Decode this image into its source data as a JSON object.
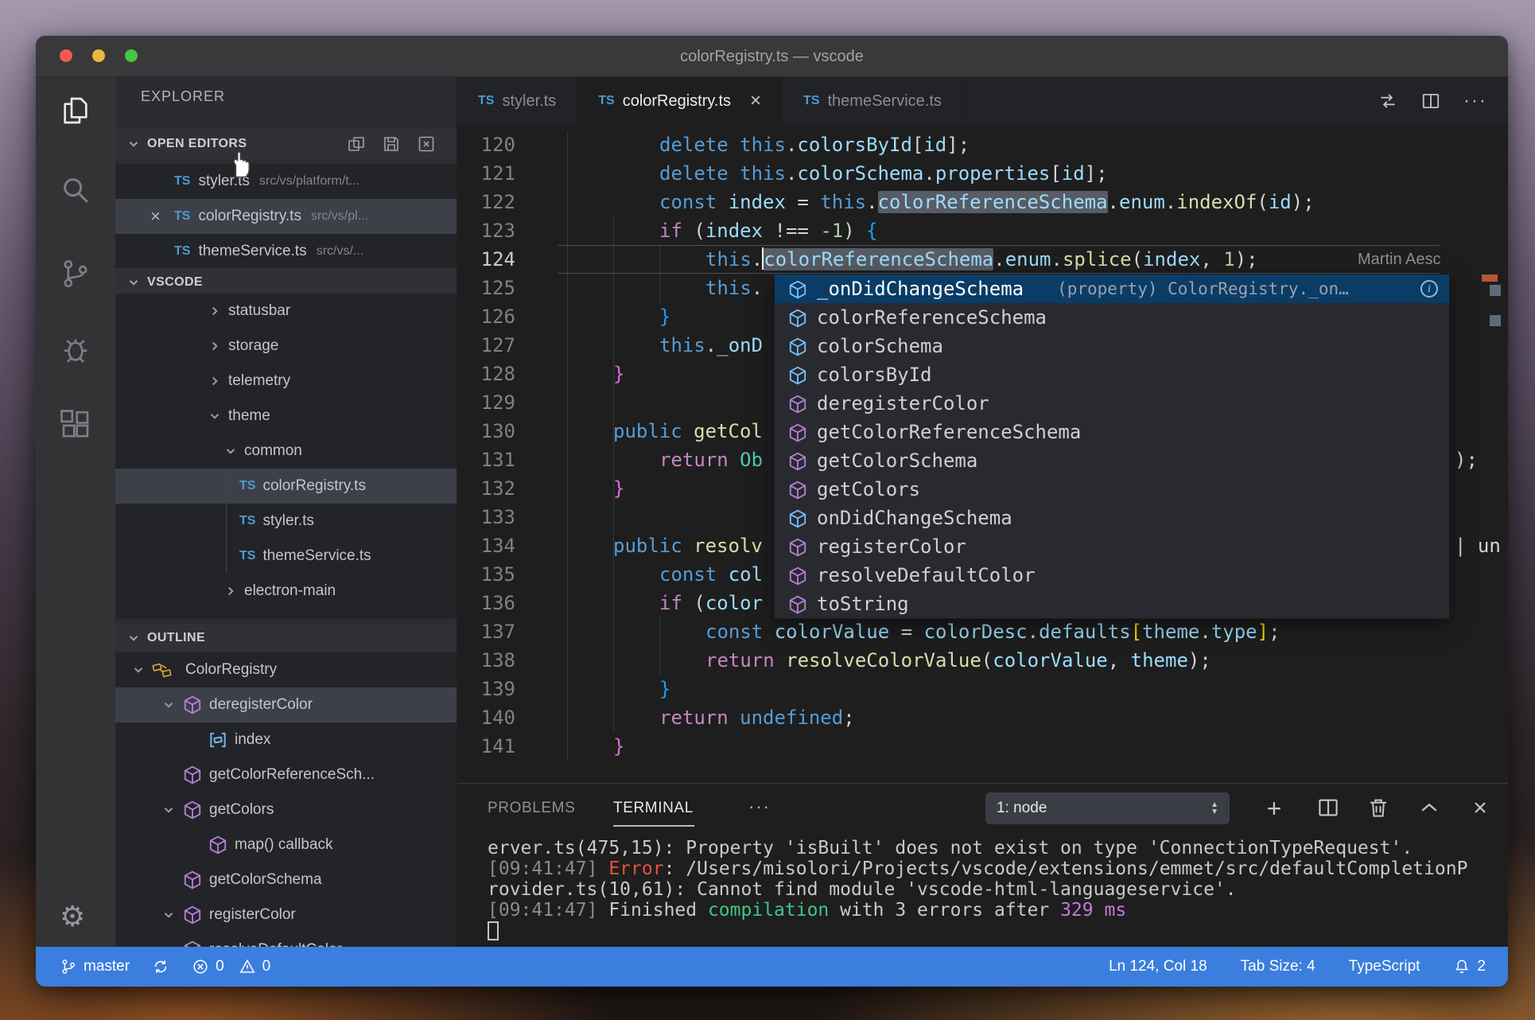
{
  "window": {
    "title": "colorRegistry.ts — vscode"
  },
  "icons": {
    "close": "×",
    "more": "···",
    "plus": "+",
    "info": "i"
  },
  "sidebar": {
    "explorer_title": "EXPLORER",
    "open_editors": {
      "header": "OPEN EDITORS",
      "items": [
        {
          "badge": "TS",
          "name": "styler.ts",
          "path": "src/vs/platform/t...",
          "selected": false,
          "close": false
        },
        {
          "badge": "TS",
          "name": "colorRegistry.ts",
          "path": "src/vs/pl...",
          "selected": true,
          "close": true
        },
        {
          "badge": "TS",
          "name": "themeService.ts",
          "path": "src/vs/...",
          "selected": false,
          "close": false
        }
      ]
    },
    "tree": {
      "header": "VSCODE",
      "items": [
        {
          "label": "statusbar",
          "indent": 1,
          "chevron": "right"
        },
        {
          "label": "storage",
          "indent": 1,
          "chevron": "right"
        },
        {
          "label": "telemetry",
          "indent": 1,
          "chevron": "right"
        },
        {
          "label": "theme",
          "indent": 1,
          "chevron": "down"
        },
        {
          "label": "common",
          "indent": 2,
          "chevron": "down"
        },
        {
          "label": "colorRegistry.ts",
          "indent": 3,
          "file": true,
          "badge": "TS",
          "selected": true
        },
        {
          "label": "styler.ts",
          "indent": 3,
          "file": true,
          "badge": "TS"
        },
        {
          "label": "themeService.ts",
          "indent": 3,
          "file": true,
          "badge": "TS"
        },
        {
          "label": "electron-main",
          "indent": 2,
          "chevron": "right"
        }
      ]
    },
    "outline": {
      "header": "OUTLINE",
      "items": [
        {
          "label": "ColorRegistry",
          "kind": "class",
          "indent": 0,
          "chevron": "down"
        },
        {
          "label": "deregisterColor",
          "kind": "method",
          "indent": 1,
          "chevron": "down",
          "selected": true
        },
        {
          "label": "index",
          "kind": "index",
          "indent": 2
        },
        {
          "label": "getColorReferenceSch...",
          "kind": "method",
          "indent": 1
        },
        {
          "label": "getColors",
          "kind": "method",
          "indent": 1,
          "chevron": "down"
        },
        {
          "label": "map() callback",
          "kind": "method",
          "indent": 2
        },
        {
          "label": "getColorSchema",
          "kind": "method",
          "indent": 1
        },
        {
          "label": "registerColor",
          "kind": "method",
          "indent": 1,
          "chevron": "down"
        },
        {
          "label": "resolveDefaultColor",
          "kind": "method",
          "indent": 1
        }
      ]
    }
  },
  "tabs": [
    {
      "badge": "TS",
      "label": "styler.ts",
      "active": false
    },
    {
      "badge": "TS",
      "label": "colorRegistry.ts",
      "active": true,
      "close": true
    },
    {
      "badge": "TS",
      "label": "themeService.ts",
      "active": false
    }
  ],
  "editor": {
    "collab_label": "Martin Aesc",
    "fragments": [
      {
        "line": "131",
        "text": ");"
      },
      {
        "line": "134",
        "text": "| un"
      }
    ],
    "lines": [
      {
        "n": "120",
        "i": 2,
        "t": [
          [
            "kw",
            "delete"
          ],
          [
            "pl",
            " "
          ],
          [
            "kw",
            "this"
          ],
          [
            "pl",
            "."
          ],
          [
            "id",
            "colorsById"
          ],
          [
            "pl",
            "["
          ],
          [
            "id",
            "id"
          ],
          [
            "pl",
            "];"
          ]
        ]
      },
      {
        "n": "121",
        "i": 2,
        "t": [
          [
            "kw",
            "delete"
          ],
          [
            "pl",
            " "
          ],
          [
            "kw",
            "this"
          ],
          [
            "pl",
            "."
          ],
          [
            "id",
            "colorSchema"
          ],
          [
            "pl",
            "."
          ],
          [
            "id",
            "properties"
          ],
          [
            "pl",
            "["
          ],
          [
            "id",
            "id"
          ],
          [
            "pl",
            "];"
          ]
        ]
      },
      {
        "n": "122",
        "i": 2,
        "t": [
          [
            "kw",
            "const"
          ],
          [
            "pl",
            " "
          ],
          [
            "id",
            "index"
          ],
          [
            "pl",
            " = "
          ],
          [
            "kw",
            "this"
          ],
          [
            "pl",
            "."
          ],
          [
            "hl",
            "colorReferenceSchema"
          ],
          [
            "pl",
            "."
          ],
          [
            "id",
            "enum"
          ],
          [
            "pl",
            "."
          ],
          [
            "fn",
            "indexOf"
          ],
          [
            "pl",
            "("
          ],
          [
            "id",
            "id"
          ],
          [
            "pl",
            ");"
          ]
        ]
      },
      {
        "n": "123",
        "i": 2,
        "t": [
          [
            "ctl",
            "if"
          ],
          [
            "pl",
            " ("
          ],
          [
            "id",
            "index"
          ],
          [
            "pl",
            " !== "
          ],
          [
            "num",
            "-1"
          ],
          [
            "pl",
            ") "
          ],
          [
            "bb",
            "{"
          ]
        ]
      },
      {
        "n": "124",
        "i": 3,
        "current": true,
        "t": [
          [
            "kw",
            "this"
          ],
          [
            "pl",
            "."
          ],
          [
            "caret",
            ""
          ],
          [
            "hl",
            "colorReferenceSchema"
          ],
          [
            "pl",
            "."
          ],
          [
            "id",
            "enum"
          ],
          [
            "pl",
            "."
          ],
          [
            "fn",
            "splice"
          ],
          [
            "pl",
            "("
          ],
          [
            "id",
            "index"
          ],
          [
            "pl",
            ", "
          ],
          [
            "num",
            "1"
          ],
          [
            "pl",
            ");"
          ]
        ]
      },
      {
        "n": "125",
        "i": 3,
        "t": [
          [
            "kw",
            "this"
          ],
          [
            "pl",
            "."
          ]
        ]
      },
      {
        "n": "126",
        "i": 2,
        "t": [
          [
            "bb",
            "}"
          ]
        ]
      },
      {
        "n": "127",
        "i": 2,
        "t": [
          [
            "kw",
            "this"
          ],
          [
            "pl",
            "."
          ],
          [
            "id",
            "_onD"
          ]
        ]
      },
      {
        "n": "128",
        "i": 1,
        "t": [
          [
            "bp",
            "}"
          ]
        ]
      },
      {
        "n": "129",
        "i": 0,
        "t": []
      },
      {
        "n": "130",
        "i": 1,
        "t": [
          [
            "kw",
            "public"
          ],
          [
            "pl",
            " "
          ],
          [
            "fn",
            "getCol"
          ]
        ]
      },
      {
        "n": "131",
        "i": 2,
        "t": [
          [
            "ctl",
            "return"
          ],
          [
            "pl",
            " "
          ],
          [
            "cls",
            "Ob"
          ]
        ]
      },
      {
        "n": "132",
        "i": 1,
        "t": [
          [
            "bp",
            "}"
          ]
        ]
      },
      {
        "n": "133",
        "i": 0,
        "t": []
      },
      {
        "n": "134",
        "i": 1,
        "t": [
          [
            "kw",
            "public"
          ],
          [
            "pl",
            " "
          ],
          [
            "fn",
            "resolv"
          ]
        ]
      },
      {
        "n": "135",
        "i": 2,
        "t": [
          [
            "kw",
            "const"
          ],
          [
            "pl",
            " "
          ],
          [
            "id",
            "col"
          ]
        ]
      },
      {
        "n": "136",
        "i": 2,
        "t": [
          [
            "ctl",
            "if"
          ],
          [
            "pl",
            " ("
          ],
          [
            "id",
            "color"
          ]
        ]
      },
      {
        "n": "137",
        "i": 3,
        "t": [
          [
            "kw",
            "const"
          ],
          [
            "pl",
            " "
          ],
          [
            "id",
            "colorValue"
          ],
          [
            "pl",
            " = "
          ],
          [
            "id",
            "colorDesc"
          ],
          [
            "pl",
            "."
          ],
          [
            "id",
            "defaults"
          ],
          [
            "bg",
            "["
          ],
          [
            "id",
            "theme"
          ],
          [
            "pl",
            "."
          ],
          [
            "id",
            "type"
          ],
          [
            "bg",
            "]"
          ],
          [
            "pl",
            ";"
          ]
        ]
      },
      {
        "n": "138",
        "i": 3,
        "t": [
          [
            "ctl",
            "return"
          ],
          [
            "pl",
            " "
          ],
          [
            "fn",
            "resolveColorValue"
          ],
          [
            "pl",
            "("
          ],
          [
            "id",
            "colorValue"
          ],
          [
            "pl",
            ", "
          ],
          [
            "id",
            "theme"
          ],
          [
            "pl",
            ");"
          ]
        ]
      },
      {
        "n": "139",
        "i": 2,
        "t": [
          [
            "bb",
            "}"
          ]
        ]
      },
      {
        "n": "140",
        "i": 2,
        "t": [
          [
            "ctl",
            "return"
          ],
          [
            "pl",
            " "
          ],
          [
            "kw",
            "undefined"
          ],
          [
            "pl",
            ";"
          ]
        ]
      },
      {
        "n": "141",
        "i": 1,
        "t": [
          [
            "bp",
            "}"
          ]
        ]
      }
    ]
  },
  "suggest": {
    "items": [
      {
        "label": "_onDidChangeSchema",
        "kind": "field",
        "selected": true,
        "detail": "(property) ColorRegistry._on…",
        "info": true
      },
      {
        "label": "colorReferenceSchema",
        "kind": "field"
      },
      {
        "label": "colorSchema",
        "kind": "field"
      },
      {
        "label": "colorsById",
        "kind": "field"
      },
      {
        "label": "deregisterColor",
        "kind": "method"
      },
      {
        "label": "getColorReferenceSchema",
        "kind": "method"
      },
      {
        "label": "getColorSchema",
        "kind": "method"
      },
      {
        "label": "getColors",
        "kind": "method"
      },
      {
        "label": "onDidChangeSchema",
        "kind": "field"
      },
      {
        "label": "registerColor",
        "kind": "method"
      },
      {
        "label": "resolveDefaultColor",
        "kind": "method"
      },
      {
        "label": "toString",
        "kind": "method"
      }
    ]
  },
  "panel": {
    "problems_label": "PROBLEMS",
    "terminal_label": "TERMINAL",
    "more": "···",
    "terminal_select": "1: node",
    "terminal_lines": [
      [
        [
          "t",
          "erver.ts(475,15): Property 'isBuilt' does not exist on type 'ConnectionTypeRequest'."
        ]
      ],
      [
        [
          "dim",
          "[09:41:47] "
        ],
        [
          "err",
          "Error"
        ],
        [
          "t",
          ": /Users/misolori/Projects/vscode/extensions/emmet/src/defaultCompletionP"
        ]
      ],
      [
        [
          "t",
          "rovider.ts(10,61): Cannot find module 'vscode-html-languageservice'."
        ]
      ],
      [
        [
          "dim",
          "[09:41:47] "
        ],
        [
          "t",
          "Finished "
        ],
        [
          "grn",
          "compilation"
        ],
        [
          "t",
          " with 3 errors after "
        ],
        [
          "mag",
          "329 ms"
        ]
      ]
    ]
  },
  "status_bar": {
    "branch": "master",
    "errors": "0",
    "warnings": "0",
    "line_col": "Ln 124, Col 18",
    "tab_size": "Tab Size: 4",
    "language": "TypeScript",
    "bell_count": "2"
  },
  "colors": {
    "status_bar": "#3b7edd",
    "field_icon": "#75beff",
    "method_icon": "#b57fd6",
    "class_icon": "#e0a23f",
    "error_red": "#e5533f",
    "success_green": "#3fc586",
    "duration_magenta": "#c678dd"
  }
}
